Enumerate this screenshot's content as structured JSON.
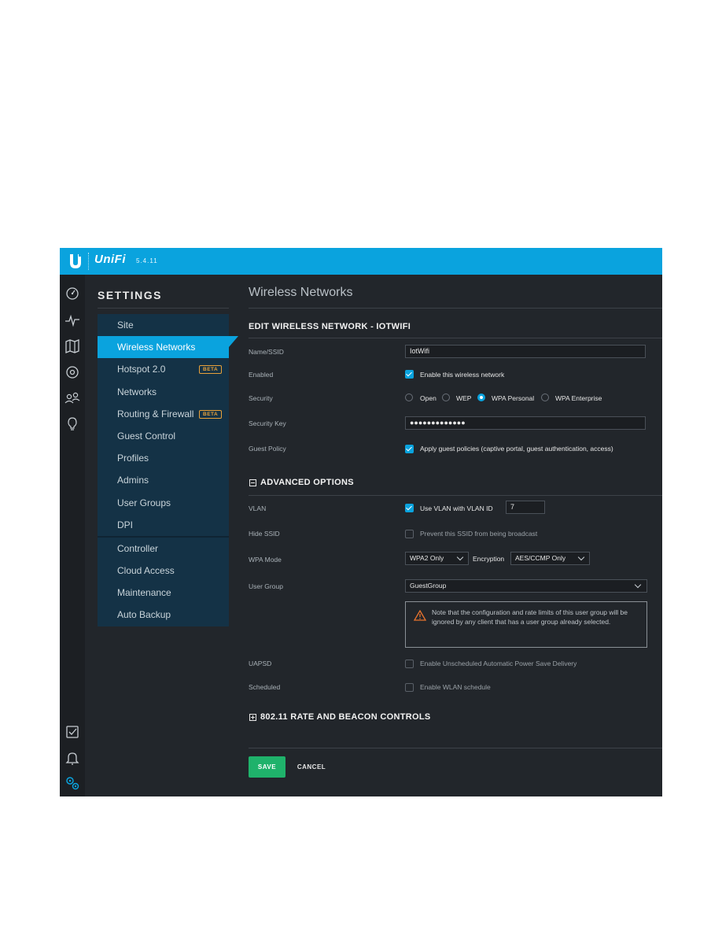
{
  "header": {
    "brand": "UniFi",
    "version": "5.4.11"
  },
  "sidebar": {
    "title": "SETTINGS",
    "items": [
      {
        "label": "Site"
      },
      {
        "label": "Wireless Networks",
        "active": true
      },
      {
        "label": "Hotspot 2.0",
        "badge": "BETA"
      },
      {
        "label": "Networks"
      },
      {
        "label": "Routing & Firewall",
        "badge": "BETA"
      },
      {
        "label": "Guest Control"
      },
      {
        "label": "Profiles"
      },
      {
        "label": "Admins"
      },
      {
        "label": "User Groups"
      },
      {
        "label": "DPI"
      },
      {
        "label": "Controller"
      },
      {
        "label": "Cloud Access"
      },
      {
        "label": "Maintenance"
      },
      {
        "label": "Auto Backup"
      }
    ]
  },
  "iconbar": [
    "dashboard-icon",
    "statistics-icon",
    "map-icon",
    "devices-icon",
    "clients-icon",
    "insights-icon",
    "tasks-icon",
    "alerts-icon",
    "settings-icon"
  ],
  "main": {
    "title": "Wireless Networks",
    "edit_heading": "EDIT WIRELESS NETWORK - IOTWIFI",
    "name_label": "Name/SSID",
    "name_value": "IotWifi",
    "enabled_label": "Enabled",
    "enabled_text": "Enable this wireless network",
    "security_label": "Security",
    "security_options": [
      "Open",
      "WEP",
      "WPA Personal",
      "WPA Enterprise"
    ],
    "security_selected": "WPA Personal",
    "key_label": "Security Key",
    "key_value": "●●●●●●●●●●●●●",
    "guest_label": "Guest Policy",
    "guest_text": "Apply guest policies (captive portal, guest authentication, access)",
    "advanced_heading": "ADVANCED OPTIONS",
    "vlan_label": "VLAN",
    "vlan_text": "Use VLAN  with VLAN ID",
    "vlan_id": "7",
    "hide_label": "Hide SSID",
    "hide_text": "Prevent this SSID from being broadcast",
    "wpa_mode_label": "WPA Mode",
    "wpa_mode_value": "WPA2 Only",
    "encryption_label": "Encryption",
    "encryption_value": "AES/CCMP Only",
    "user_group_label": "User Group",
    "user_group_value": "GuestGroup",
    "warning_text": "Note that the configuration and rate limits of this user group will be ignored by any client that has a user group already selected.",
    "uapsd_label": "UAPSD",
    "uapsd_text": "Enable Unscheduled Automatic Power Save Delivery",
    "scheduled_label": "Scheduled",
    "scheduled_text": "Enable WLAN schedule",
    "rate_heading": "802.11 RATE AND BEACON CONTROLS",
    "save_label": "SAVE",
    "cancel_label": "CANCEL"
  },
  "colors": {
    "accent": "#0aa3de",
    "save": "#1fb26b",
    "warning": "#e8732e",
    "beta": "#e8a13a",
    "background": "#22262b"
  }
}
